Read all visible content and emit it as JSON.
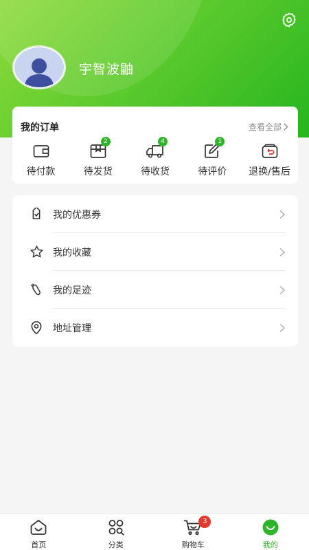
{
  "header": {
    "username": "宇智波鼬"
  },
  "orders": {
    "title": "我的订单",
    "view_all": "查看全部",
    "items": [
      {
        "label": "待付款",
        "icon": "wallet-icon",
        "badge": null
      },
      {
        "label": "待发货",
        "icon": "package-icon",
        "badge": "2"
      },
      {
        "label": "待收货",
        "icon": "truck-icon",
        "badge": "4"
      },
      {
        "label": "待评价",
        "icon": "edit-icon",
        "badge": "1"
      },
      {
        "label": "退换/售后",
        "icon": "return-icon",
        "badge": null
      }
    ]
  },
  "menu": {
    "items": [
      {
        "label": "我的优惠券",
        "icon": "coupon-icon"
      },
      {
        "label": "我的收藏",
        "icon": "star-icon"
      },
      {
        "label": "我的足迹",
        "icon": "footprint-icon"
      },
      {
        "label": "地址管理",
        "icon": "location-icon"
      }
    ]
  },
  "tabbar": {
    "items": [
      {
        "label": "首页",
        "icon": "home-icon"
      },
      {
        "label": "分类",
        "icon": "category-icon"
      },
      {
        "label": "购物车",
        "icon": "cart-icon",
        "badge": "3"
      },
      {
        "label": "我的",
        "icon": "profile-icon",
        "active": true
      }
    ]
  },
  "colors": {
    "accent": "#2fb52a",
    "header_start": "#8fdb3c",
    "header_end": "#26b51f",
    "badge_red": "#e23a2a"
  }
}
